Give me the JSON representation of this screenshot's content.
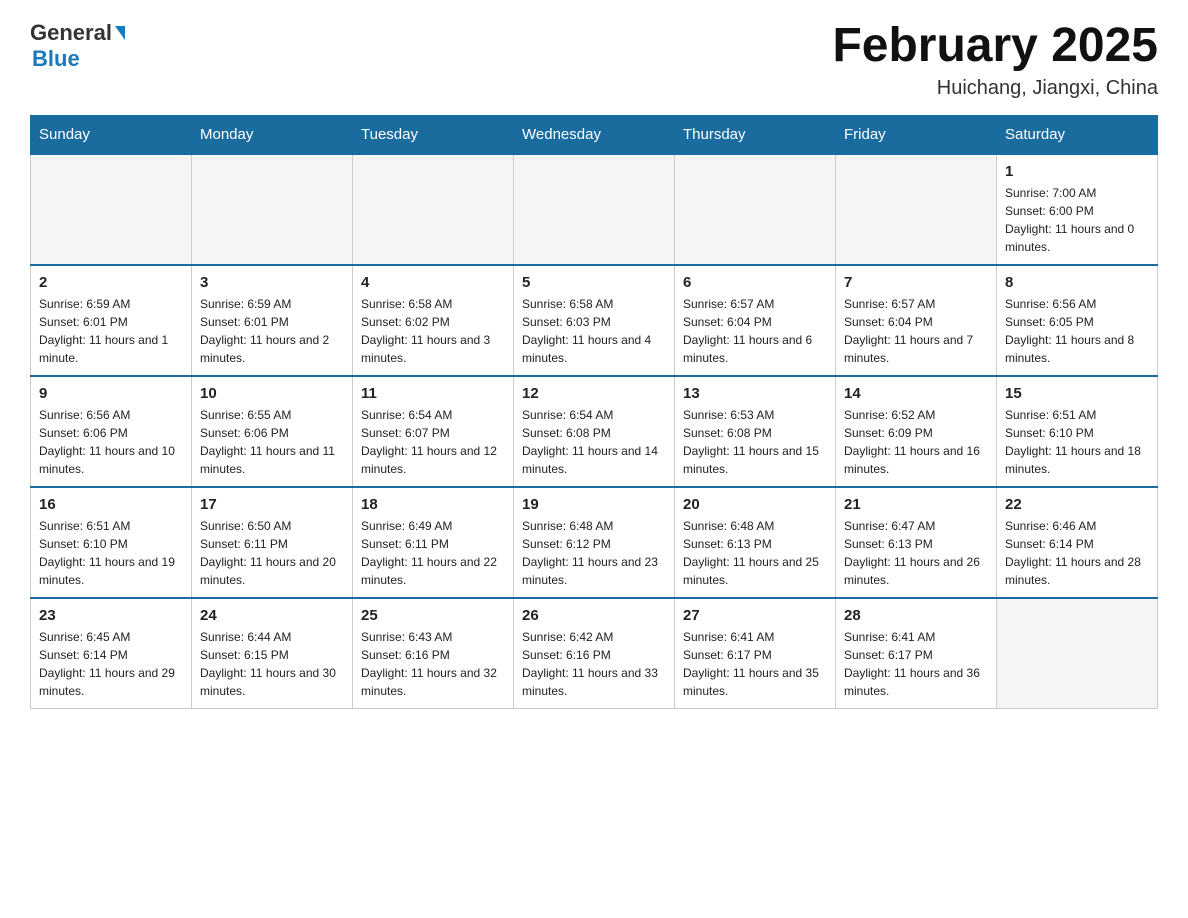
{
  "logo": {
    "general": "General",
    "blue": "Blue"
  },
  "title": {
    "month_year": "February 2025",
    "location": "Huichang, Jiangxi, China"
  },
  "headers": [
    "Sunday",
    "Monday",
    "Tuesday",
    "Wednesday",
    "Thursday",
    "Friday",
    "Saturday"
  ],
  "weeks": [
    [
      {
        "day": "",
        "info": "",
        "empty": true
      },
      {
        "day": "",
        "info": "",
        "empty": true
      },
      {
        "day": "",
        "info": "",
        "empty": true
      },
      {
        "day": "",
        "info": "",
        "empty": true
      },
      {
        "day": "",
        "info": "",
        "empty": true
      },
      {
        "day": "",
        "info": "",
        "empty": true
      },
      {
        "day": "1",
        "info": "Sunrise: 7:00 AM\nSunset: 6:00 PM\nDaylight: 11 hours and 0 minutes.",
        "empty": false
      }
    ],
    [
      {
        "day": "2",
        "info": "Sunrise: 6:59 AM\nSunset: 6:01 PM\nDaylight: 11 hours and 1 minute.",
        "empty": false
      },
      {
        "day": "3",
        "info": "Sunrise: 6:59 AM\nSunset: 6:01 PM\nDaylight: 11 hours and 2 minutes.",
        "empty": false
      },
      {
        "day": "4",
        "info": "Sunrise: 6:58 AM\nSunset: 6:02 PM\nDaylight: 11 hours and 3 minutes.",
        "empty": false
      },
      {
        "day": "5",
        "info": "Sunrise: 6:58 AM\nSunset: 6:03 PM\nDaylight: 11 hours and 4 minutes.",
        "empty": false
      },
      {
        "day": "6",
        "info": "Sunrise: 6:57 AM\nSunset: 6:04 PM\nDaylight: 11 hours and 6 minutes.",
        "empty": false
      },
      {
        "day": "7",
        "info": "Sunrise: 6:57 AM\nSunset: 6:04 PM\nDaylight: 11 hours and 7 minutes.",
        "empty": false
      },
      {
        "day": "8",
        "info": "Sunrise: 6:56 AM\nSunset: 6:05 PM\nDaylight: 11 hours and 8 minutes.",
        "empty": false
      }
    ],
    [
      {
        "day": "9",
        "info": "Sunrise: 6:56 AM\nSunset: 6:06 PM\nDaylight: 11 hours and 10 minutes.",
        "empty": false
      },
      {
        "day": "10",
        "info": "Sunrise: 6:55 AM\nSunset: 6:06 PM\nDaylight: 11 hours and 11 minutes.",
        "empty": false
      },
      {
        "day": "11",
        "info": "Sunrise: 6:54 AM\nSunset: 6:07 PM\nDaylight: 11 hours and 12 minutes.",
        "empty": false
      },
      {
        "day": "12",
        "info": "Sunrise: 6:54 AM\nSunset: 6:08 PM\nDaylight: 11 hours and 14 minutes.",
        "empty": false
      },
      {
        "day": "13",
        "info": "Sunrise: 6:53 AM\nSunset: 6:08 PM\nDaylight: 11 hours and 15 minutes.",
        "empty": false
      },
      {
        "day": "14",
        "info": "Sunrise: 6:52 AM\nSunset: 6:09 PM\nDaylight: 11 hours and 16 minutes.",
        "empty": false
      },
      {
        "day": "15",
        "info": "Sunrise: 6:51 AM\nSunset: 6:10 PM\nDaylight: 11 hours and 18 minutes.",
        "empty": false
      }
    ],
    [
      {
        "day": "16",
        "info": "Sunrise: 6:51 AM\nSunset: 6:10 PM\nDaylight: 11 hours and 19 minutes.",
        "empty": false
      },
      {
        "day": "17",
        "info": "Sunrise: 6:50 AM\nSunset: 6:11 PM\nDaylight: 11 hours and 20 minutes.",
        "empty": false
      },
      {
        "day": "18",
        "info": "Sunrise: 6:49 AM\nSunset: 6:11 PM\nDaylight: 11 hours and 22 minutes.",
        "empty": false
      },
      {
        "day": "19",
        "info": "Sunrise: 6:48 AM\nSunset: 6:12 PM\nDaylight: 11 hours and 23 minutes.",
        "empty": false
      },
      {
        "day": "20",
        "info": "Sunrise: 6:48 AM\nSunset: 6:13 PM\nDaylight: 11 hours and 25 minutes.",
        "empty": false
      },
      {
        "day": "21",
        "info": "Sunrise: 6:47 AM\nSunset: 6:13 PM\nDaylight: 11 hours and 26 minutes.",
        "empty": false
      },
      {
        "day": "22",
        "info": "Sunrise: 6:46 AM\nSunset: 6:14 PM\nDaylight: 11 hours and 28 minutes.",
        "empty": false
      }
    ],
    [
      {
        "day": "23",
        "info": "Sunrise: 6:45 AM\nSunset: 6:14 PM\nDaylight: 11 hours and 29 minutes.",
        "empty": false
      },
      {
        "day": "24",
        "info": "Sunrise: 6:44 AM\nSunset: 6:15 PM\nDaylight: 11 hours and 30 minutes.",
        "empty": false
      },
      {
        "day": "25",
        "info": "Sunrise: 6:43 AM\nSunset: 6:16 PM\nDaylight: 11 hours and 32 minutes.",
        "empty": false
      },
      {
        "day": "26",
        "info": "Sunrise: 6:42 AM\nSunset: 6:16 PM\nDaylight: 11 hours and 33 minutes.",
        "empty": false
      },
      {
        "day": "27",
        "info": "Sunrise: 6:41 AM\nSunset: 6:17 PM\nDaylight: 11 hours and 35 minutes.",
        "empty": false
      },
      {
        "day": "28",
        "info": "Sunrise: 6:41 AM\nSunset: 6:17 PM\nDaylight: 11 hours and 36 minutes.",
        "empty": false
      },
      {
        "day": "",
        "info": "",
        "empty": true
      }
    ]
  ]
}
